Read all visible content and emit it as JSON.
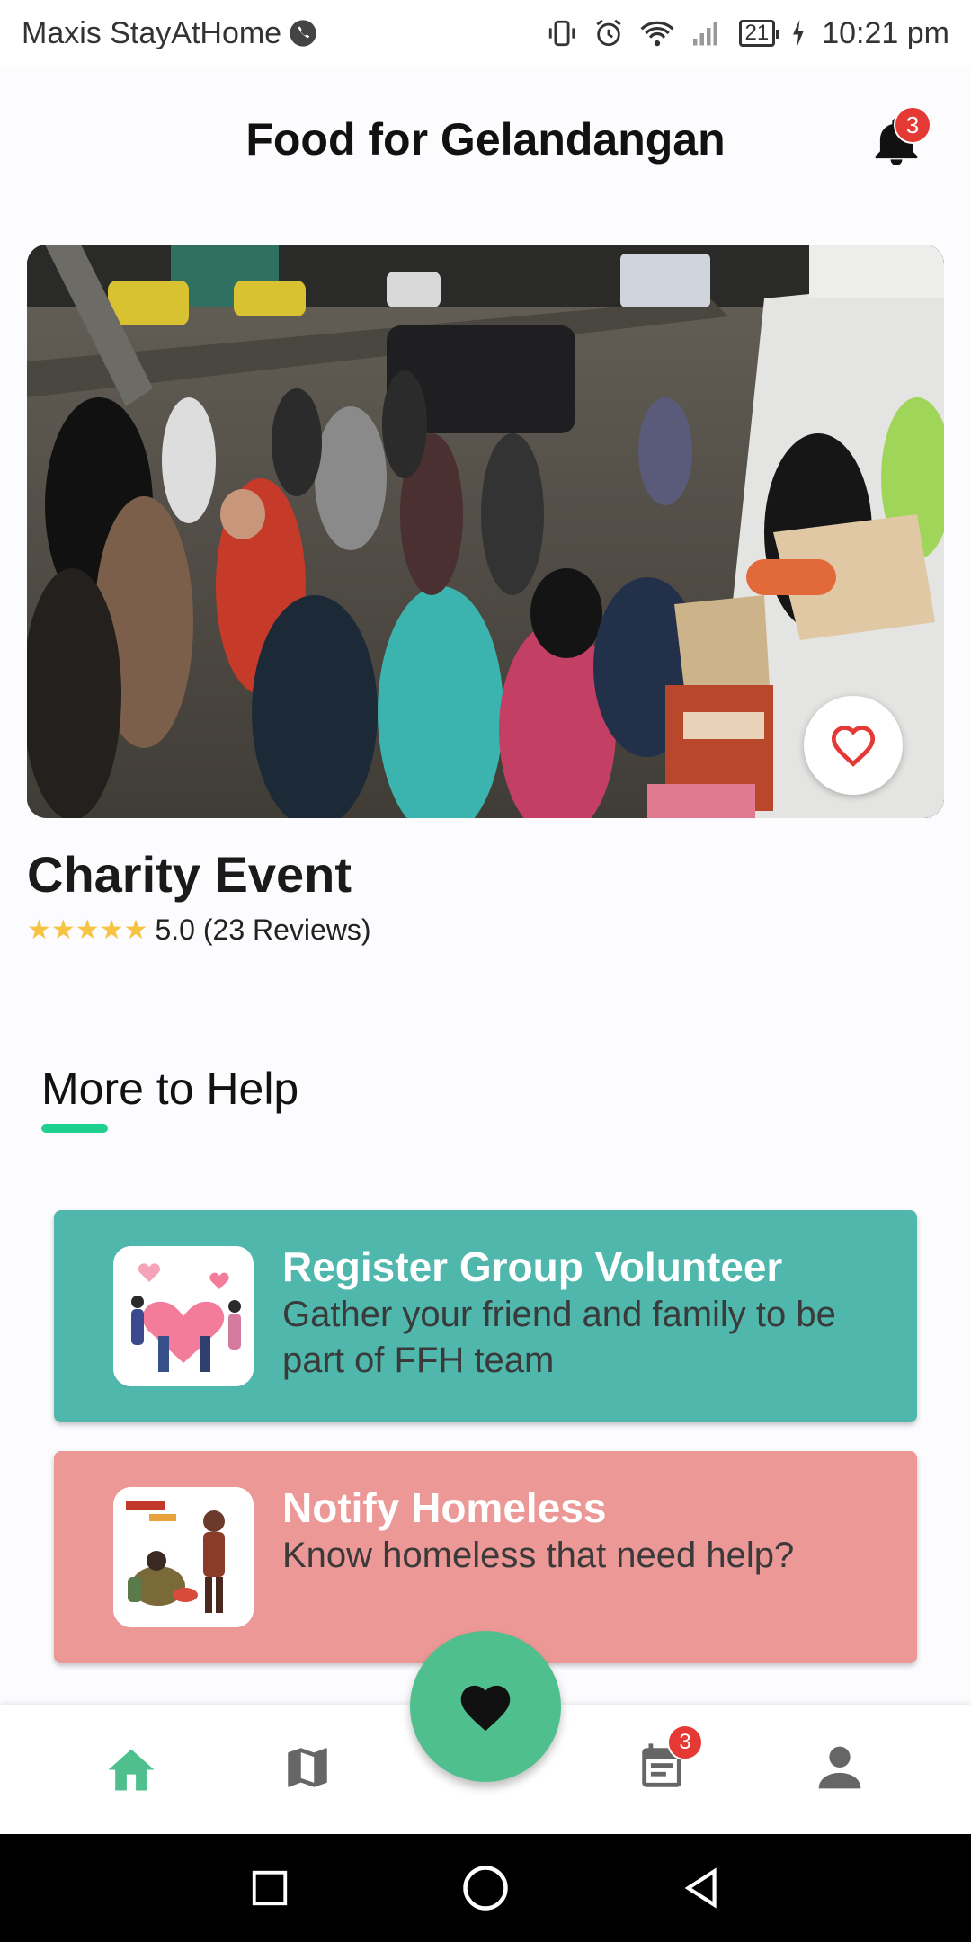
{
  "status_bar": {
    "carrier": "Maxis StayAtHome",
    "battery": "21",
    "time": "10:21 pm"
  },
  "header": {
    "title": "Food for Gelandangan",
    "notification_count": "3"
  },
  "event": {
    "title": "Charity Event",
    "rating": 5.0,
    "rating_text": "5.0 (23 Reviews)",
    "stars": "★★★★★"
  },
  "section": {
    "title": "More to Help"
  },
  "cards": [
    {
      "title": "Register Group Volunteer",
      "description": "Gather your friend and family to be part of FFH team",
      "background": "#4fb7ab"
    },
    {
      "title": "Notify Homeless",
      "description": "Know homeless that need help?",
      "background": "#ec9897"
    }
  ],
  "nav": {
    "active_color": "#4fc08d",
    "inactive_color": "#666666",
    "calendar_badge": "3",
    "items": [
      "home-icon",
      "map-icon",
      "heart-icon",
      "calendar-icon",
      "person-icon"
    ]
  },
  "colors": {
    "accent": "#1fd08f",
    "fab": "#4fc08d",
    "badge": "#e53935",
    "star": "#f6c342"
  }
}
